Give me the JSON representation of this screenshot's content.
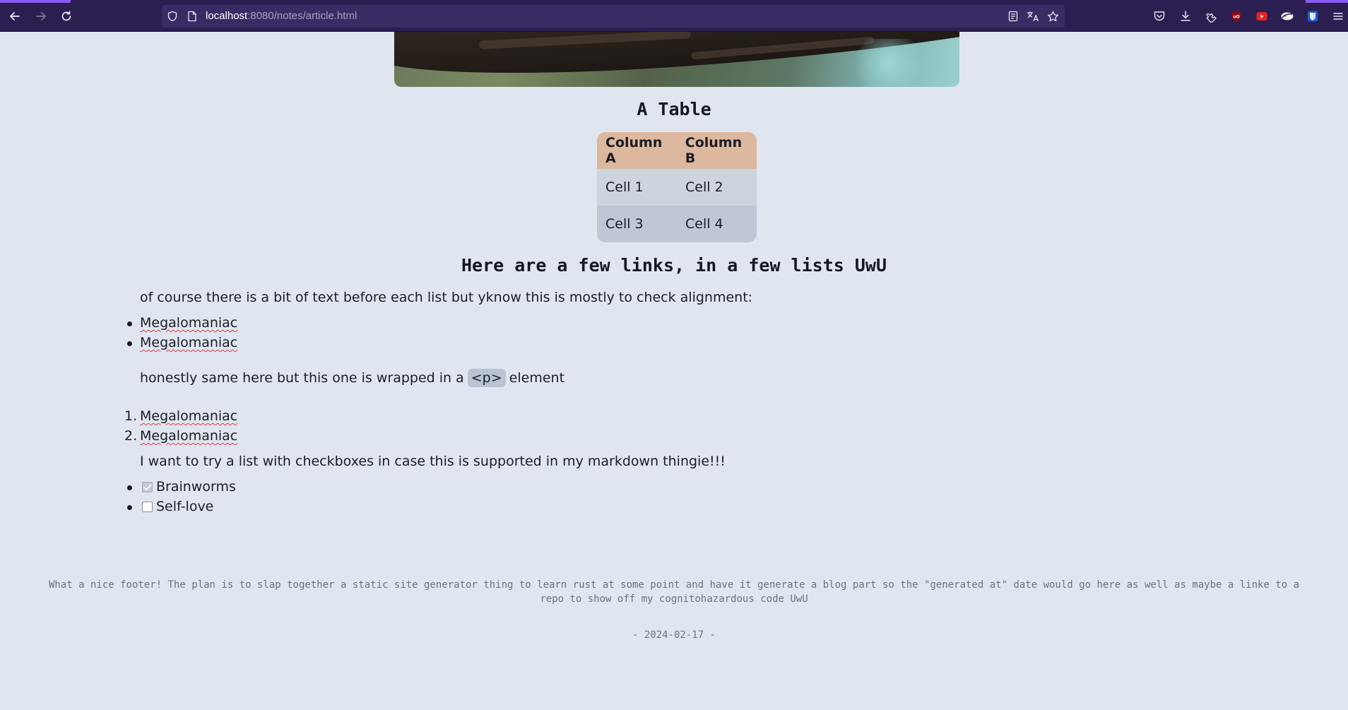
{
  "browser": {
    "url_host": "localhost",
    "url_rest": ":8080/notes/article.html",
    "colors": {
      "toolbar": "#2b1e50",
      "urlbar": "#3a2c63",
      "accent": "#8a5cf5"
    },
    "toolbar_icons": [
      "back-arrow-icon",
      "forward-arrow-icon",
      "reload-icon",
      "shield-icon",
      "page-icon",
      "reader-view-icon",
      "translate-icon",
      "bookmark-star-icon",
      "pocket-icon",
      "download-icon",
      "extensions-icon",
      "ublock-icon",
      "youtube-icon",
      "extension-icon",
      "bitwarden-icon",
      "menu-icon"
    ]
  },
  "article": {
    "table_heading": "A Table",
    "table": {
      "headers": [
        "Column A",
        "Column B"
      ],
      "rows": [
        [
          "Cell 1",
          "Cell 2"
        ],
        [
          "Cell 3",
          "Cell 4"
        ]
      ],
      "colors": {
        "header": "#dcb89e",
        "row_odd": "#cdd4de",
        "row_even": "#bec7d3"
      }
    },
    "links_heading": "Here are a few links, in a few lists UwU",
    "intro_text": "of course there is a bit of text before each list but yknow this is mostly to check alignment:",
    "unordered_links": [
      "Megalomaniac",
      "Megalomaniac"
    ],
    "p_text_before": "honestly same here but this one is wrapped in a",
    "p_code": "<p>",
    "p_text_after": "element",
    "ordered_links": [
      "Megalomaniac",
      "Megalomaniac"
    ],
    "ordered_markers": [
      "1.",
      "2."
    ],
    "checkbox_intro": "I want to try a list with checkboxes in case this is supported in my markdown thingie!!!",
    "checklist": [
      {
        "label": "Brainworms",
        "checked": true
      },
      {
        "label": "Self-love",
        "checked": false
      }
    ]
  },
  "footer": {
    "text": "What a nice footer! The plan is to slap together a static site generator thing to learn rust at some point and have it generate a blog part so the \"generated at\" date would go here as well as maybe a linke to a repo to show off my cognitohazardous code UwU",
    "date": "- 2024-02-17 -"
  }
}
